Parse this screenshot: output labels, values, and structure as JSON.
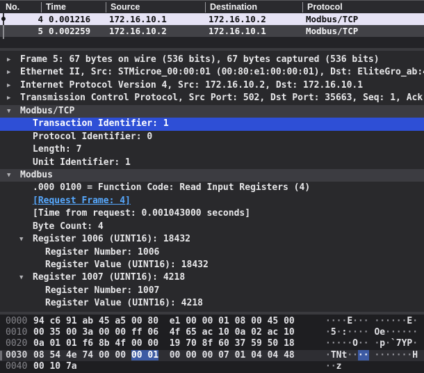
{
  "packet_list": {
    "columns": [
      {
        "label": "No."
      },
      {
        "label": "Time"
      },
      {
        "label": "Source"
      },
      {
        "label": "Destination"
      },
      {
        "label": "Protocol"
      }
    ],
    "rows": [
      {
        "no": "4",
        "time": "0.001216",
        "source": "172.16.10.1",
        "destination": "172.16.10.2",
        "protocol": "Modbus/TCP",
        "state": "colored",
        "related_dot": true
      },
      {
        "no": "5",
        "time": "0.002259",
        "source": "172.16.10.2",
        "destination": "172.16.10.1",
        "protocol": "Modbus/TCP",
        "state": "selected_inactive",
        "related_dot": false
      }
    ]
  },
  "details": {
    "rows": [
      {
        "level": 0,
        "arrow": "collapsed",
        "text": "Frame 5: 67 bytes on wire (536 bits), 67 bytes captured (536 bits)",
        "variant": "default"
      },
      {
        "level": 0,
        "arrow": "collapsed",
        "text": "Ethernet II, Src: STMicroe_00:00:01 (00:80:e1:00:00:01), Dst: EliteGro_ab:4",
        "variant": "default"
      },
      {
        "level": 0,
        "arrow": "collapsed",
        "text": "Internet Protocol Version 4, Src: 172.16.10.2, Dst: 172.16.10.1",
        "variant": "default"
      },
      {
        "level": 0,
        "arrow": "collapsed",
        "text": "Transmission Control Protocol, Src Port: 502, Dst Port: 35663, Seq: 1, Ack:",
        "variant": "default"
      },
      {
        "level": 0,
        "arrow": "expanded",
        "text": "Modbus/TCP",
        "variant": "proto_root"
      },
      {
        "level": 1,
        "arrow": null,
        "text": "Transaction Identifier: 1",
        "variant": "selected"
      },
      {
        "level": 1,
        "arrow": null,
        "text": "Protocol Identifier: 0",
        "variant": "default"
      },
      {
        "level": 1,
        "arrow": null,
        "text": "Length: 7",
        "variant": "default"
      },
      {
        "level": 1,
        "arrow": null,
        "text": "Unit Identifier: 1",
        "variant": "default"
      },
      {
        "level": 0,
        "arrow": "expanded",
        "text": "Modbus",
        "variant": "proto_root"
      },
      {
        "level": 1,
        "arrow": null,
        "text": ".000 0100 = Function Code: Read Input Registers (4)",
        "variant": "default"
      },
      {
        "level": 1,
        "arrow": null,
        "text": "[Request Frame: 4]",
        "variant": "link"
      },
      {
        "level": 1,
        "arrow": null,
        "text": "[Time from request: 0.001043000 seconds]",
        "variant": "default"
      },
      {
        "level": 1,
        "arrow": null,
        "text": "Byte Count: 4",
        "variant": "default"
      },
      {
        "level": 1,
        "arrow": "expanded",
        "text": "Register 1006 (UINT16): 18432",
        "variant": "default"
      },
      {
        "level": 2,
        "arrow": null,
        "text": "Register Number: 1006",
        "variant": "default"
      },
      {
        "level": 2,
        "arrow": null,
        "text": "Register Value (UINT16): 18432",
        "variant": "default"
      },
      {
        "level": 1,
        "arrow": "expanded",
        "text": "Register 1007 (UINT16): 4218",
        "variant": "default"
      },
      {
        "level": 2,
        "arrow": null,
        "text": "Register Number: 1007",
        "variant": "default"
      },
      {
        "level": 2,
        "arrow": null,
        "text": "Register Value (UINT16): 4218",
        "variant": "default"
      }
    ]
  },
  "hex_dump": {
    "rows": [
      {
        "offset": "0000",
        "bytes": [
          "94",
          "c6",
          "91",
          "ab",
          "45",
          "a5",
          "00",
          "80",
          "e1",
          "00",
          "00",
          "01",
          "08",
          "00",
          "45",
          "00"
        ],
        "ascii": "····E·········E·"
      },
      {
        "offset": "0010",
        "bytes": [
          "00",
          "35",
          "00",
          "3a",
          "00",
          "00",
          "ff",
          "06",
          "4f",
          "65",
          "ac",
          "10",
          "0a",
          "02",
          "ac",
          "10"
        ],
        "ascii": "·5·:····Oe······"
      },
      {
        "offset": "0020",
        "bytes": [
          "0a",
          "01",
          "01",
          "f6",
          "8b",
          "4f",
          "00",
          "00",
          "19",
          "70",
          "8f",
          "60",
          "37",
          "59",
          "50",
          "18"
        ],
        "ascii": "·····O···p·`7YP·"
      },
      {
        "offset": "0030",
        "bytes": [
          "08",
          "54",
          "4e",
          "74",
          "00",
          "00",
          "00",
          "01",
          "00",
          "00",
          "00",
          "07",
          "01",
          "04",
          "04",
          "48"
        ],
        "ascii": "·TNt···········H"
      },
      {
        "offset": "0040",
        "bytes": [
          "00",
          "10",
          "7a"
        ],
        "ascii": "··z"
      }
    ],
    "current_row_index": 3,
    "selection": {
      "row_index": 3,
      "byte_start": 6,
      "byte_end": 7
    }
  },
  "colors": {
    "selected_field_blue": "#2e4fd6",
    "packet_color_lavender": "#e6e3f5",
    "inactive_selection_gray": "#424247",
    "link_blue": "#57a9ff",
    "byte_highlight_blue": "#3d5ba4",
    "proto_root_gray": "#3c3c41"
  }
}
